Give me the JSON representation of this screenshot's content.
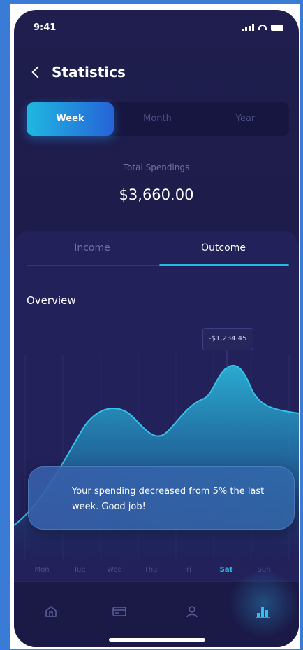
{
  "status_bar": {
    "time": "9:41"
  },
  "header": {
    "title": "Statistics"
  },
  "period_tabs": [
    {
      "label": "Week",
      "active": true
    },
    {
      "label": "Month",
      "active": false
    },
    {
      "label": "Year",
      "active": false
    }
  ],
  "summary": {
    "label": "Total Spendings",
    "value": "$3,660.00"
  },
  "type_tabs": [
    {
      "label": "Income",
      "active": false
    },
    {
      "label": "Outcome",
      "active": true
    }
  ],
  "overview": {
    "title": "Overview",
    "tooltip": "-$1,234.45"
  },
  "toast": {
    "message": "Your spending decreased from 5% the last week. Good job!"
  },
  "days": [
    {
      "label": "Mon",
      "active": false
    },
    {
      "label": "Tue",
      "active": false
    },
    {
      "label": "Wed",
      "active": false
    },
    {
      "label": "Thu",
      "active": false
    },
    {
      "label": "Fri",
      "active": false
    },
    {
      "label": "Sat",
      "active": true
    },
    {
      "label": "Sun",
      "active": false
    }
  ],
  "nav": [
    {
      "icon": "home-icon",
      "active": false
    },
    {
      "icon": "card-icon",
      "active": false
    },
    {
      "icon": "profile-icon",
      "active": false
    },
    {
      "icon": "statistics-icon",
      "active": true
    }
  ],
  "colors": {
    "accent": "#28b8e6",
    "background": "#1f1e4e",
    "panel": "#22215a"
  }
}
